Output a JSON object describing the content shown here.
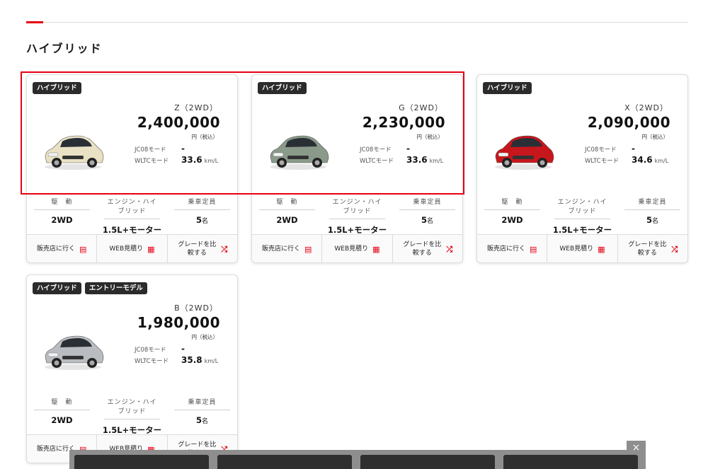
{
  "section": {
    "title": "ハイブリッド"
  },
  "cards": [
    {
      "badges": [
        "ハイブリッド"
      ],
      "grade": "Z（2WD）",
      "price": "2,400,000",
      "price_unit": "円（税込）",
      "jc08_label": "JC08モード",
      "jc08_value": "-",
      "wltc_label": "WLTCモード",
      "wltc_value": "33.6",
      "wltc_unit": "km/L",
      "car_color": "#e8e1c4",
      "specs": [
        {
          "header": "駆　動",
          "value": "2WD"
        },
        {
          "header": "エンジン・ハイブリッド",
          "value": "1.5L+モーター"
        },
        {
          "header": "乗車定員",
          "value": "5",
          "suffix": "名"
        }
      ],
      "actions": {
        "dealer": "販売店に行く",
        "estimate": "WEB見積り",
        "compare": "グレードを比較する"
      }
    },
    {
      "badges": [
        "ハイブリッド"
      ],
      "grade": "G（2WD）",
      "price": "2,230,000",
      "price_unit": "円（税込）",
      "jc08_label": "JC08モード",
      "jc08_value": "-",
      "wltc_label": "WLTCモード",
      "wltc_value": "33.6",
      "wltc_unit": "km/L",
      "car_color": "#8a9a8a",
      "specs": [
        {
          "header": "駆　動",
          "value": "2WD"
        },
        {
          "header": "エンジン・ハイブリッド",
          "value": "1.5L+モーター"
        },
        {
          "header": "乗車定員",
          "value": "5",
          "suffix": "名"
        }
      ],
      "actions": {
        "dealer": "販売店に行く",
        "estimate": "WEB見積り",
        "compare": "グレードを比較する"
      }
    },
    {
      "badges": [
        "ハイブリッド"
      ],
      "grade": "X（2WD）",
      "price": "2,090,000",
      "price_unit": "円（税込）",
      "jc08_label": "JC08モード",
      "jc08_value": "-",
      "wltc_label": "WLTCモード",
      "wltc_value": "34.6",
      "wltc_unit": "km/L",
      "car_color": "#c8161d",
      "specs": [
        {
          "header": "駆　動",
          "value": "2WD"
        },
        {
          "header": "エンジン・ハイブリッド",
          "value": "1.5L+モーター"
        },
        {
          "header": "乗車定員",
          "value": "5",
          "suffix": "名"
        }
      ],
      "actions": {
        "dealer": "販売店に行く",
        "estimate": "WEB見積り",
        "compare": "グレードを比較する"
      }
    },
    {
      "badges": [
        "ハイブリッド",
        "エントリーモデル"
      ],
      "grade": "B（2WD）",
      "price": "1,980,000",
      "price_unit": "円（税込）",
      "jc08_label": "JC08モード",
      "jc08_value": "-",
      "wltc_label": "WLTCモード",
      "wltc_value": "35.8",
      "wltc_unit": "km/L",
      "car_color": "#b9bcc0",
      "specs": [
        {
          "header": "駆　動",
          "value": "2WD"
        },
        {
          "header": "エンジン・ハイブリッド",
          "value": "1.5L+モーター"
        },
        {
          "header": "乗車定員",
          "value": "5",
          "suffix": "名"
        }
      ],
      "actions": {
        "dealer": "販売店に行く",
        "estimate": "WEB見積り",
        "compare": "グレードを比較する"
      }
    }
  ],
  "icons": {
    "dealer": "store-icon",
    "estimate": "calculator-icon",
    "compare": "shuffle-icon",
    "close": "close-icon"
  },
  "bottom_bar": {
    "close_label": "×"
  },
  "colors": {
    "accent": "#e60012",
    "badge_bg": "#2b2b2b"
  }
}
